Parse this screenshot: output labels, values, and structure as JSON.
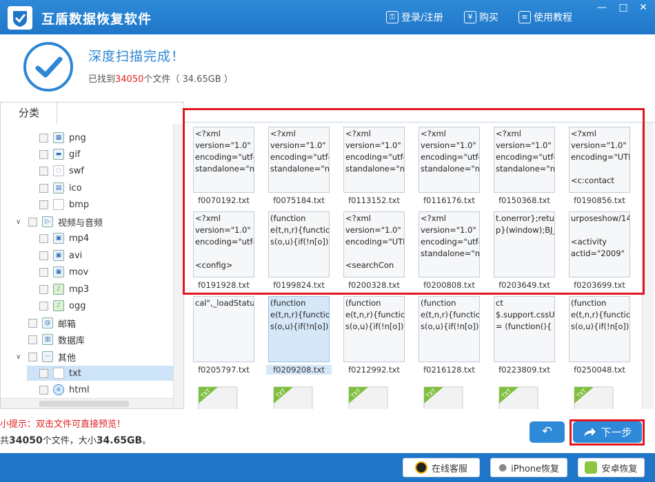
{
  "app": {
    "title": "互盾数据恢复软件",
    "login_label": "登录/注册",
    "buy_label": "购买",
    "tutorial_label": "使用教程",
    "buy_symbol": "¥",
    "window_min": "—",
    "window_max": "□",
    "window_close": "✕"
  },
  "status": {
    "title": "深度扫描完成！",
    "found_prefix": "已找到",
    "found_count": "34050",
    "found_suffix": "个文件（ 34.65GB ）"
  },
  "sidebar": {
    "tab_label": "分类",
    "items": [
      {
        "label": "png",
        "icon": "image-icon"
      },
      {
        "label": "gif",
        "icon": "image-icon"
      },
      {
        "label": "swf",
        "icon": "flash-icon"
      },
      {
        "label": "ico",
        "icon": "icon-file-icon"
      },
      {
        "label": "bmp",
        "icon": "document-icon"
      },
      {
        "label": "视频与音频",
        "icon": "video-icon"
      },
      {
        "label": "mp4",
        "icon": "video-file-icon"
      },
      {
        "label": "avi",
        "icon": "video-file-icon"
      },
      {
        "label": "mov",
        "icon": "video-file-icon"
      },
      {
        "label": "mp3",
        "icon": "audio-file-icon"
      },
      {
        "label": "ogg",
        "icon": "audio-file-icon"
      },
      {
        "label": "邮箱",
        "icon": "email-icon"
      },
      {
        "label": "数据库",
        "icon": "database-icon"
      },
      {
        "label": "其他",
        "icon": "other-icon"
      },
      {
        "label": "txt",
        "icon": "txt-file-icon"
      },
      {
        "label": "html",
        "icon": "globe-icon"
      }
    ]
  },
  "files": {
    "row1": [
      {
        "name": "f0070192.txt",
        "preview": "<?xml\nversion=\"1.0\"\nencoding=\"utf-\nstandalone=\"n"
      },
      {
        "name": "f0075184.txt",
        "preview": "<?xml\nversion=\"1.0\"\nencoding=\"utf-\nstandalone=\"n"
      },
      {
        "name": "f0113152.txt",
        "preview": "<?xml\nversion=\"1.0\"\nencoding=\"utf-\nstandalone=\"n"
      },
      {
        "name": "f0116176.txt",
        "preview": "<?xml\nversion=\"1.0\"\nencoding=\"utf-\nstandalone=\"n"
      },
      {
        "name": "f0150368.txt",
        "preview": "<?xml\nversion=\"1.0\"\nencoding=\"utf-\nstandalone=\"n"
      },
      {
        "name": "f0190856.txt",
        "preview": "<?xml\nversion=\"1.0\"\nencoding=\"UTI\n\n<c:contact"
      }
    ],
    "row2": [
      {
        "name": "f0191928.txt",
        "preview": "<?xml\nversion=\"1.0\"\nencoding=\"utf-\n\n<config>"
      },
      {
        "name": "f0199824.txt",
        "preview": "(function\ne(t,n,r){function\ns(o,u){if(!n[o]){i"
      },
      {
        "name": "f0200328.txt",
        "preview": "<?xml\nversion=\"1.0\"\nencoding=\"UTI\n\n<searchCon"
      },
      {
        "name": "f0200808.txt",
        "preview": "<?xml\nversion=\"1.0\"\nencoding=\"utf-\nstandalone=\"n"
      },
      {
        "name": "f0203649.txt",
        "preview": "t.onerror};retur\np}(window);BJ_"
      },
      {
        "name": "f0203699.txt",
        "preview": "urposeshow/14\n\n<activity\nactid=\"2009\""
      }
    ],
    "row3": [
      {
        "name": "f0205797.txt",
        "preview": "cal\",_loadStatus"
      },
      {
        "name": "f0209208.txt",
        "preview": "(function\ne(t,n,r){function\ns(o,u){if(!n[o]){i"
      },
      {
        "name": "f0212992.txt",
        "preview": "(function\ne(t,n,r){function\ns(o,u){if(!n[o]){i"
      },
      {
        "name": "f0216128.txt",
        "preview": "(function\ne(t,n,r){function\ns(o,u){if(!n[o]){i"
      },
      {
        "name": "f0223809.txt",
        "preview": "ct\n$.support.cssU\n= (function(){"
      },
      {
        "name": "f0250048.txt",
        "preview": "(function\ne(t,n,r){function\ns(o,u){if(!n[o]){i"
      }
    ],
    "row4_label": "TXT"
  },
  "hint": {
    "text": "小提示：双击文件可直接预览！",
    "summary_prefix": "共",
    "summary_count": "34050",
    "summary_mid": "个文件，大小",
    "summary_size": "34.65GB",
    "summary_suffix": "。"
  },
  "actions": {
    "back_symbol": "↶",
    "next_label": "下一步"
  },
  "footer": {
    "online_service": "在线客服",
    "iphone_recovery": "iPhone恢复",
    "android_recovery": "安卓恢复"
  },
  "colors": {
    "brand_blue": "#1f76c8",
    "highlight_red": "#e3141b",
    "count_red": "#e02020"
  }
}
